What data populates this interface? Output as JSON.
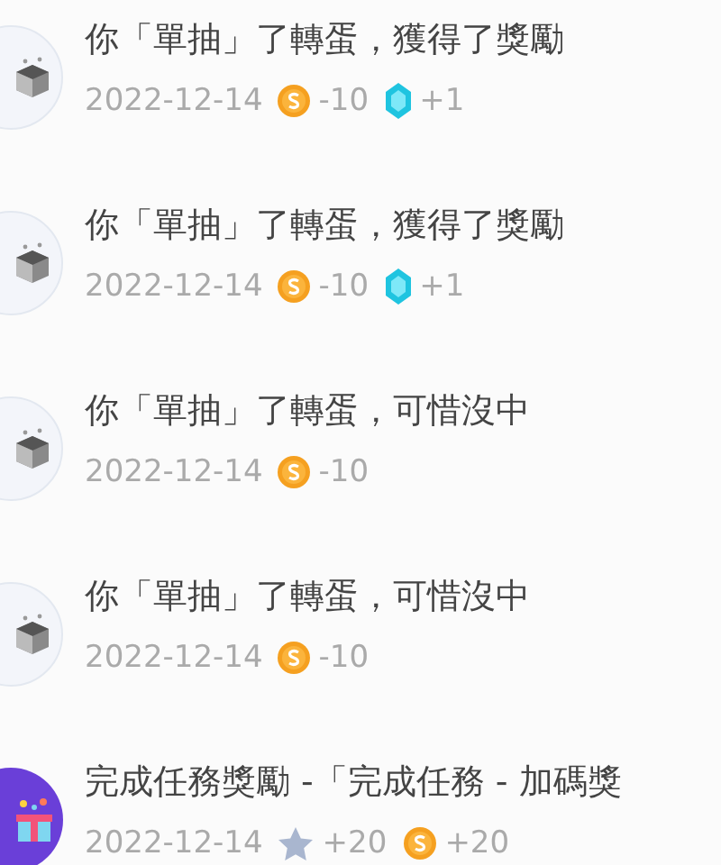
{
  "records": [
    {
      "avatar": {
        "kind": "box"
      },
      "title": "你「單抽」了轉蛋，獲得了獎勵",
      "date": "2022-12-14",
      "rewards": [
        {
          "kind": "coin",
          "amount": "-10"
        },
        {
          "kind": "gem",
          "amount": "+1"
        }
      ]
    },
    {
      "avatar": {
        "kind": "box"
      },
      "title": "你「單抽」了轉蛋，獲得了獎勵",
      "date": "2022-12-14",
      "rewards": [
        {
          "kind": "coin",
          "amount": "-10"
        },
        {
          "kind": "gem",
          "amount": "+1"
        }
      ]
    },
    {
      "avatar": {
        "kind": "box"
      },
      "title": "你「單抽」了轉蛋，可惜沒中",
      "date": "2022-12-14",
      "rewards": [
        {
          "kind": "coin",
          "amount": "-10"
        }
      ]
    },
    {
      "avatar": {
        "kind": "box"
      },
      "title": "你「單抽」了轉蛋，可惜沒中",
      "date": "2022-12-14",
      "rewards": [
        {
          "kind": "coin",
          "amount": "-10"
        }
      ]
    },
    {
      "avatar": {
        "kind": "gift"
      },
      "title": "完成任務獎勵 -「完成任務 - 加碼獎",
      "date": "2022-12-14",
      "rewards": [
        {
          "kind": "star",
          "amount": "+20"
        },
        {
          "kind": "coin",
          "amount": "+20"
        }
      ]
    }
  ]
}
